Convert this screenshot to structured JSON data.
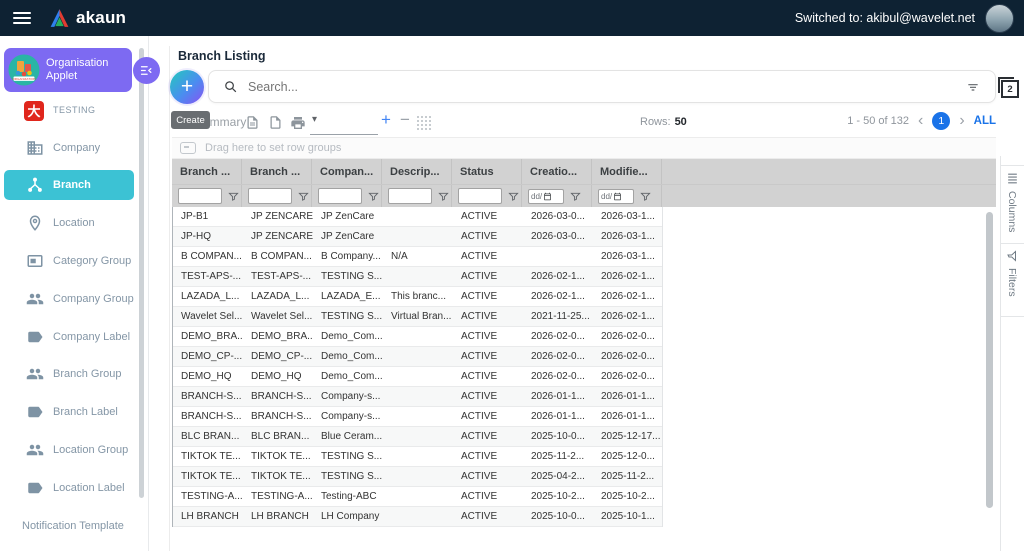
{
  "topbar": {
    "brand": "akaun",
    "switched_to": "Switched to: akibul@wavelet.net"
  },
  "sidebar": {
    "applet_title": "Organisation Applet",
    "items": [
      {
        "label": "TESTING",
        "icon": "testing",
        "active": false
      },
      {
        "label": "Company",
        "icon": "company",
        "active": false
      },
      {
        "label": "Branch",
        "icon": "branch",
        "active": true
      },
      {
        "label": "Location",
        "icon": "location",
        "active": false
      },
      {
        "label": "Category Group",
        "icon": "category-group",
        "active": false
      },
      {
        "label": "Company Group",
        "icon": "group",
        "active": false
      },
      {
        "label": "Company Label",
        "icon": "label",
        "active": false
      },
      {
        "label": "Branch Group",
        "icon": "group",
        "active": false
      },
      {
        "label": "Branch Label",
        "icon": "label",
        "active": false
      },
      {
        "label": "Location Group",
        "icon": "group",
        "active": false
      },
      {
        "label": "Location Label",
        "icon": "label",
        "active": false
      },
      {
        "label": "Notification Template",
        "icon": "none",
        "active": false
      }
    ]
  },
  "main": {
    "title": "Branch Listing",
    "search_placeholder": "Search...",
    "create_tooltip": "Create",
    "summary_label": "Summary",
    "rows_label": "Rows:",
    "rows_value": "50",
    "pagination": {
      "range": "1 - 50 of 132",
      "page": "1",
      "all_label": "ALL"
    },
    "drag_hint": "Drag here to set row groups",
    "table": {
      "columns": [
        "Branch ...",
        "Branch ...",
        "Compan...",
        "Descrip...",
        "Status",
        "Creatio...",
        "Modifie..."
      ],
      "date_filter_placeholder": "dd/",
      "rows": [
        [
          "JP-B1",
          "JP ZENCARE",
          "JP ZenCare",
          "",
          "ACTIVE",
          "2026-03-0...",
          "2026-03-1..."
        ],
        [
          "JP-HQ",
          "JP ZENCARE",
          "JP ZenCare",
          "",
          "ACTIVE",
          "2026-03-0...",
          "2026-03-1..."
        ],
        [
          "B COMPAN...",
          "B COMPAN...",
          "B Company...",
          "N/A",
          "ACTIVE",
          "",
          "2026-03-1..."
        ],
        [
          "TEST-APS-...",
          "TEST-APS-...",
          "TESTING S...",
          "",
          "ACTIVE",
          "2026-02-1...",
          "2026-02-1..."
        ],
        [
          "LAZADA_L...",
          "LAZADA_L...",
          "LAZADA_E...",
          "This branc...",
          "ACTIVE",
          "2026-02-1...",
          "2026-02-1..."
        ],
        [
          "Wavelet Sel...",
          "Wavelet Sel...",
          "TESTING S...",
          "Virtual Bran...",
          "ACTIVE",
          "2021-11-25...",
          "2026-02-1..."
        ],
        [
          "DEMO_BRA...",
          "DEMO_BRA...",
          "Demo_Com...",
          "",
          "ACTIVE",
          "2026-02-0...",
          "2026-02-0..."
        ],
        [
          "DEMO_CP-...",
          "DEMO_CP-...",
          "Demo_Com...",
          "",
          "ACTIVE",
          "2026-02-0...",
          "2026-02-0..."
        ],
        [
          "DEMO_HQ",
          "DEMO_HQ",
          "Demo_Com...",
          "",
          "ACTIVE",
          "2026-02-0...",
          "2026-02-0..."
        ],
        [
          "BRANCH-S...",
          "BRANCH-S...",
          "Company-s...",
          "",
          "ACTIVE",
          "2026-01-1...",
          "2026-01-1..."
        ],
        [
          "BRANCH-S...",
          "BRANCH-S...",
          "Company-s...",
          "",
          "ACTIVE",
          "2026-01-1...",
          "2026-01-1..."
        ],
        [
          "BLC BRAN...",
          "BLC BRAN...",
          "Blue Ceram...",
          "",
          "ACTIVE",
          "2025-10-0...",
          "2025-12-17..."
        ],
        [
          "TIKTOK TE...",
          "TIKTOK TE...",
          "TESTING S...",
          "",
          "ACTIVE",
          "2025-11-2...",
          "2025-12-0..."
        ],
        [
          "TIKTOK TE...",
          "TIKTOK TE...",
          "TESTING S...",
          "",
          "ACTIVE",
          "2025-04-2...",
          "2025-11-2..."
        ],
        [
          "TESTING-A...",
          "TESTING-A...",
          "Testing-ABC",
          "",
          "ACTIVE",
          "2025-10-2...",
          "2025-10-2..."
        ],
        [
          "LH BRANCH",
          "LH BRANCH",
          "LH Company",
          "",
          "ACTIVE",
          "2025-10-0...",
          "2025-10-1..."
        ]
      ]
    },
    "side_tabs": [
      {
        "label": "Columns",
        "icon": "columns"
      },
      {
        "label": "Filters",
        "icon": "filter"
      }
    ]
  },
  "colors": {
    "topbar": "#0e2233",
    "applet_purple": "#7d6af2",
    "active_teal": "#3cc2d4",
    "link_blue": "#1a73e8",
    "header_gray": "#d2d2d2"
  }
}
